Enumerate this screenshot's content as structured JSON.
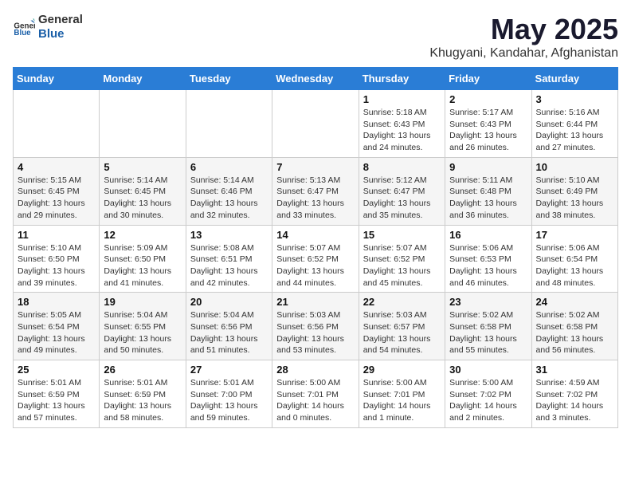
{
  "logo": {
    "text_general": "General",
    "text_blue": "Blue"
  },
  "title": "May 2025",
  "subtitle": "Khugyani, Kandahar, Afghanistan",
  "days_of_week": [
    "Sunday",
    "Monday",
    "Tuesday",
    "Wednesday",
    "Thursday",
    "Friday",
    "Saturday"
  ],
  "weeks": [
    [
      {
        "day": "",
        "info": ""
      },
      {
        "day": "",
        "info": ""
      },
      {
        "day": "",
        "info": ""
      },
      {
        "day": "",
        "info": ""
      },
      {
        "day": "1",
        "info": "Sunrise: 5:18 AM\nSunset: 6:43 PM\nDaylight: 13 hours\nand 24 minutes."
      },
      {
        "day": "2",
        "info": "Sunrise: 5:17 AM\nSunset: 6:43 PM\nDaylight: 13 hours\nand 26 minutes."
      },
      {
        "day": "3",
        "info": "Sunrise: 5:16 AM\nSunset: 6:44 PM\nDaylight: 13 hours\nand 27 minutes."
      }
    ],
    [
      {
        "day": "4",
        "info": "Sunrise: 5:15 AM\nSunset: 6:45 PM\nDaylight: 13 hours\nand 29 minutes."
      },
      {
        "day": "5",
        "info": "Sunrise: 5:14 AM\nSunset: 6:45 PM\nDaylight: 13 hours\nand 30 minutes."
      },
      {
        "day": "6",
        "info": "Sunrise: 5:14 AM\nSunset: 6:46 PM\nDaylight: 13 hours\nand 32 minutes."
      },
      {
        "day": "7",
        "info": "Sunrise: 5:13 AM\nSunset: 6:47 PM\nDaylight: 13 hours\nand 33 minutes."
      },
      {
        "day": "8",
        "info": "Sunrise: 5:12 AM\nSunset: 6:47 PM\nDaylight: 13 hours\nand 35 minutes."
      },
      {
        "day": "9",
        "info": "Sunrise: 5:11 AM\nSunset: 6:48 PM\nDaylight: 13 hours\nand 36 minutes."
      },
      {
        "day": "10",
        "info": "Sunrise: 5:10 AM\nSunset: 6:49 PM\nDaylight: 13 hours\nand 38 minutes."
      }
    ],
    [
      {
        "day": "11",
        "info": "Sunrise: 5:10 AM\nSunset: 6:50 PM\nDaylight: 13 hours\nand 39 minutes."
      },
      {
        "day": "12",
        "info": "Sunrise: 5:09 AM\nSunset: 6:50 PM\nDaylight: 13 hours\nand 41 minutes."
      },
      {
        "day": "13",
        "info": "Sunrise: 5:08 AM\nSunset: 6:51 PM\nDaylight: 13 hours\nand 42 minutes."
      },
      {
        "day": "14",
        "info": "Sunrise: 5:07 AM\nSunset: 6:52 PM\nDaylight: 13 hours\nand 44 minutes."
      },
      {
        "day": "15",
        "info": "Sunrise: 5:07 AM\nSunset: 6:52 PM\nDaylight: 13 hours\nand 45 minutes."
      },
      {
        "day": "16",
        "info": "Sunrise: 5:06 AM\nSunset: 6:53 PM\nDaylight: 13 hours\nand 46 minutes."
      },
      {
        "day": "17",
        "info": "Sunrise: 5:06 AM\nSunset: 6:54 PM\nDaylight: 13 hours\nand 48 minutes."
      }
    ],
    [
      {
        "day": "18",
        "info": "Sunrise: 5:05 AM\nSunset: 6:54 PM\nDaylight: 13 hours\nand 49 minutes."
      },
      {
        "day": "19",
        "info": "Sunrise: 5:04 AM\nSunset: 6:55 PM\nDaylight: 13 hours\nand 50 minutes."
      },
      {
        "day": "20",
        "info": "Sunrise: 5:04 AM\nSunset: 6:56 PM\nDaylight: 13 hours\nand 51 minutes."
      },
      {
        "day": "21",
        "info": "Sunrise: 5:03 AM\nSunset: 6:56 PM\nDaylight: 13 hours\nand 53 minutes."
      },
      {
        "day": "22",
        "info": "Sunrise: 5:03 AM\nSunset: 6:57 PM\nDaylight: 13 hours\nand 54 minutes."
      },
      {
        "day": "23",
        "info": "Sunrise: 5:02 AM\nSunset: 6:58 PM\nDaylight: 13 hours\nand 55 minutes."
      },
      {
        "day": "24",
        "info": "Sunrise: 5:02 AM\nSunset: 6:58 PM\nDaylight: 13 hours\nand 56 minutes."
      }
    ],
    [
      {
        "day": "25",
        "info": "Sunrise: 5:01 AM\nSunset: 6:59 PM\nDaylight: 13 hours\nand 57 minutes."
      },
      {
        "day": "26",
        "info": "Sunrise: 5:01 AM\nSunset: 6:59 PM\nDaylight: 13 hours\nand 58 minutes."
      },
      {
        "day": "27",
        "info": "Sunrise: 5:01 AM\nSunset: 7:00 PM\nDaylight: 13 hours\nand 59 minutes."
      },
      {
        "day": "28",
        "info": "Sunrise: 5:00 AM\nSunset: 7:01 PM\nDaylight: 14 hours\nand 0 minutes."
      },
      {
        "day": "29",
        "info": "Sunrise: 5:00 AM\nSunset: 7:01 PM\nDaylight: 14 hours\nand 1 minute."
      },
      {
        "day": "30",
        "info": "Sunrise: 5:00 AM\nSunset: 7:02 PM\nDaylight: 14 hours\nand 2 minutes."
      },
      {
        "day": "31",
        "info": "Sunrise: 4:59 AM\nSunset: 7:02 PM\nDaylight: 14 hours\nand 3 minutes."
      }
    ]
  ]
}
